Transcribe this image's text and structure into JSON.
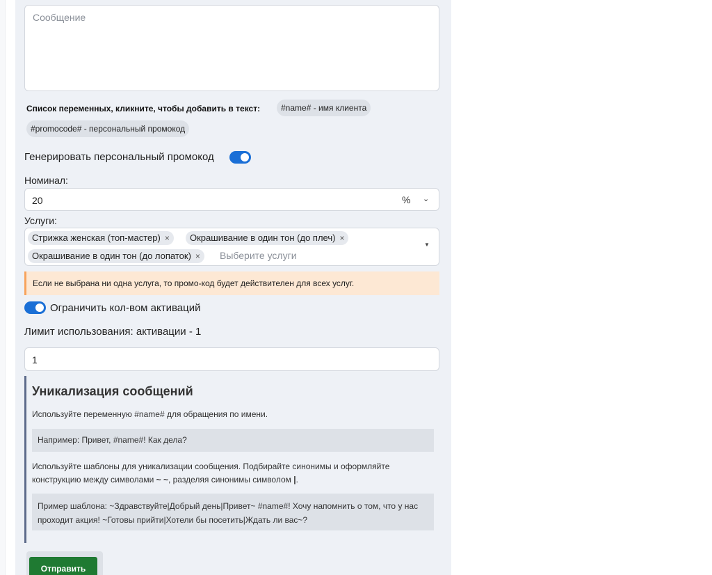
{
  "message": {
    "placeholder": "Сообщение"
  },
  "variables": {
    "label": "Список переменных, кликните, чтобы добавить в текст:",
    "items": [
      "#name# - имя клиента",
      "#promocode# - персональный промокод"
    ]
  },
  "promo_toggle": {
    "label": "Генерировать персональный промокод",
    "on": true
  },
  "nominal": {
    "label": "Номинал:",
    "value": "20",
    "unit": "%",
    "chevron_icon": "chevron-down-icon"
  },
  "services": {
    "label": "Услуги:",
    "selected": [
      "Стрижка женская (топ-мастер)",
      "Окрашивание в один тон (до плеч)",
      "Окрашивание в один тон (до лопаток)"
    ],
    "remove_glyph": "×",
    "placeholder": "Выберите услуги",
    "arrow_glyph": "▼"
  },
  "alert": {
    "text": "Если не выбрана ни одна услуга, то промо-код будет действителен для всех услуг."
  },
  "limit_toggle": {
    "label": "Ограничить кол-вом активаций",
    "on": true
  },
  "limit": {
    "label": "Лимит использования: активации - 1",
    "value": "1"
  },
  "uniq": {
    "title": "Уникализация сообщений",
    "text1": "Используйте переменную #name# для обращения по имени.",
    "example1": "Например: Привет, #name#! Как дела?",
    "text2_a": "Используйте шаблоны для уникализации сообщения. Подбирайте синонимы и оформляйте конструкцию между символами ",
    "text2_sym1": "~ ~",
    "text2_b": ", разделяя синонимы символом ",
    "text2_sym2": "|",
    "text2_c": ".",
    "example2": "Пример шаблона: ~Здравствуйте|Добрый день|Привет~ #name#! Хочу напомнить о том, что у нас проходит акция! ~Готовы прийти|Хотели бы посетить|Ждать ли вас~?"
  },
  "submit": {
    "label": "Отправить"
  },
  "colors": {
    "accent": "#1a6fd6",
    "submit": "#1f7a32",
    "alert_bg": "#fde8d4",
    "alert_border": "#f7a35c"
  }
}
